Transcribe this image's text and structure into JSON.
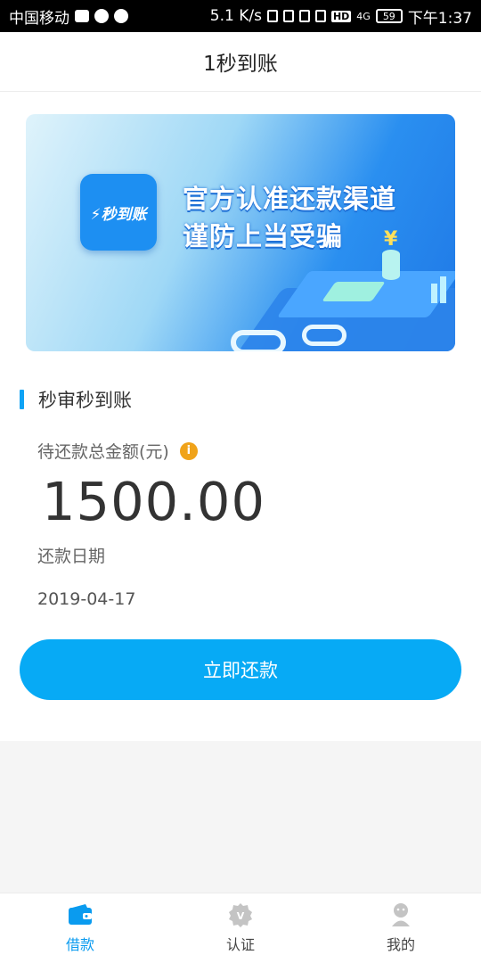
{
  "status_bar": {
    "carrier": "中国移动",
    "speed": "5.1 K/s",
    "network": "4G",
    "battery": "59",
    "time": "下午1:37"
  },
  "header": {
    "title": "1秒到账"
  },
  "banner": {
    "logo_text": "秒到账",
    "line1": "官方认准还款渠道",
    "line2": "谨防上当受骗",
    "yen": "¥"
  },
  "loan": {
    "section_title": "秒审秒到账",
    "amount_label": "待还款总金额(元)",
    "amount": "1500.00",
    "date_label": "还款日期",
    "date": "2019-04-17",
    "repay_button": "立即还款"
  },
  "tabs": [
    {
      "label": "借款",
      "icon": "wallet-icon",
      "active": true
    },
    {
      "label": "认证",
      "icon": "verify-icon",
      "active": false
    },
    {
      "label": "我的",
      "icon": "profile-icon",
      "active": false
    }
  ],
  "colors": {
    "accent": "#07aaf5",
    "tab_active": "#0a9bef",
    "tab_inactive": "#c4c4c4",
    "info": "#f0a31a"
  }
}
